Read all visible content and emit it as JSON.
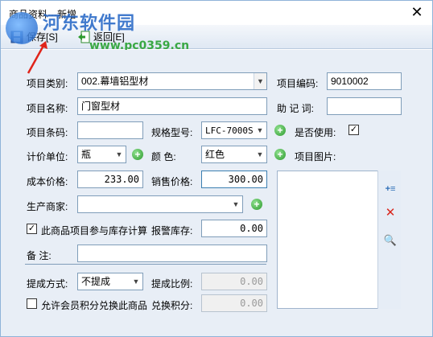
{
  "window": {
    "title": "商品资料---新增",
    "close_label": "✕"
  },
  "watermark": {
    "brand": "河东软件园",
    "url": "www.pc0359.cn"
  },
  "toolbar": {
    "save_label": "保存[S]",
    "back_label": "返回[E]"
  },
  "form": {
    "category_label": "项目类别:",
    "category_value": "002.幕墙铝型材",
    "code_label": "项目编码:",
    "code_value": "9010002",
    "name_label": "项目名称:",
    "name_value": "门窗型材",
    "mnemonic_label": "助 记 词:",
    "mnemonic_value": "",
    "barcode_label": "项目条码:",
    "barcode_value": "",
    "spec_label": "规格型号:",
    "spec_value": "LFC-7000S",
    "enabled_label": "是否使用:",
    "enabled_checked": true,
    "unit_label": "计价单位:",
    "unit_value": "瓶",
    "color_label": "颜    色:",
    "color_value": "红色",
    "image_label": "项目图片:",
    "cost_label": "成本价格:",
    "cost_value": "233.00",
    "sale_label": "销售价格:",
    "sale_value": "300.00",
    "maker_label": "生产商家:",
    "maker_value": "",
    "stock_calc_label": "此商品项目参与库存计算",
    "stock_calc_checked": true,
    "alarm_label": "报警库存:",
    "alarm_value": "0.00",
    "remark_label": "备    注:",
    "remark_value": "",
    "commission_label": "提成方式:",
    "commission_value": "不提成",
    "ratio_label": "提成比例:",
    "ratio_value": "0.00",
    "points_label": "允许会员积分兑换此商品",
    "points_checked": false,
    "exchange_label": "兑换积分:",
    "exchange_value": "0.00"
  },
  "icons": {
    "plus": "plus-icon",
    "check": "✓",
    "add_image": "+≡",
    "delete_image": "✕",
    "zoom_image": "🔍"
  },
  "colors": {
    "accent": "#3c7fb1",
    "form_bg": "#e8eef6",
    "plus_green": "#2e9b2e",
    "delete_red": "#d9261c"
  }
}
